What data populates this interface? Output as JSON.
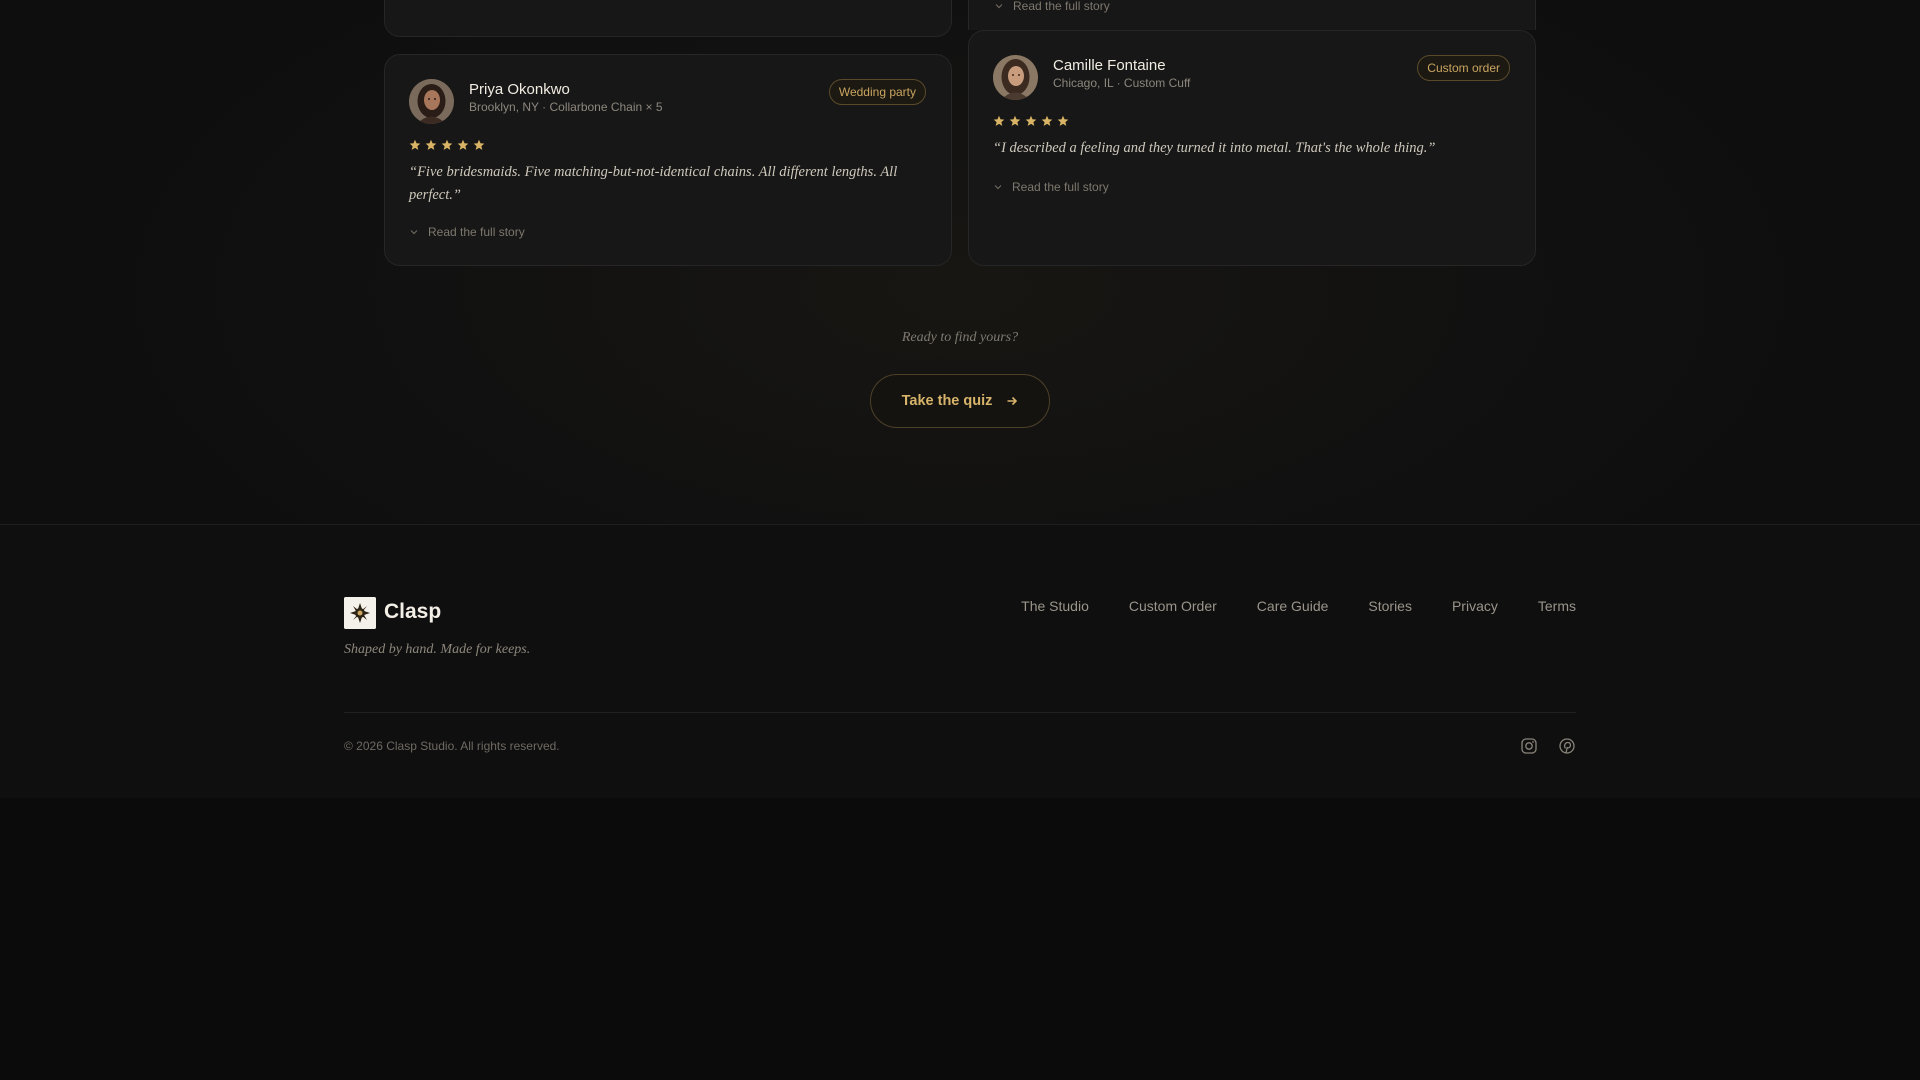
{
  "testimonials": [
    {
      "name": "",
      "meta": "",
      "badge": "",
      "quote": "",
      "read_more": "Read the full story"
    },
    {
      "name": "Priya Okonkwo",
      "meta": "Brooklyn, NY · Collarbone Chain × 5",
      "badge": "Wedding party",
      "rating": 5,
      "quote": "“Five bridesmaids. Five matching-but-not-identical chains. All different lengths. All perfect.”",
      "read_more": "Read the full story"
    },
    {
      "name": "Camille Fontaine",
      "meta": "Chicago, IL · Custom Cuff",
      "badge": "Custom order",
      "rating": 5,
      "quote": "“I described a feeling and they turned it into metal. That's the whole thing.”",
      "read_more": "Read the full story"
    }
  ],
  "cta": {
    "lead": "Ready to find yours?",
    "button_label": "Take the quiz"
  },
  "footer": {
    "brand": "Clasp",
    "tagline": "Shaped by hand. Made for keeps.",
    "nav": [
      "The Studio",
      "Custom Order",
      "Care Guide",
      "Stories",
      "Privacy",
      "Terms"
    ],
    "copyright": "© 2026 Clasp Studio. All rights reserved.",
    "social_icons": [
      "instagram-icon",
      "pinterest-icon"
    ]
  },
  "colors": {
    "accent_gold": "#d7b46a",
    "badge_gold": "#c9a560",
    "star": "#d9b465",
    "background": "#0d0d0d",
    "card": "#171717"
  }
}
